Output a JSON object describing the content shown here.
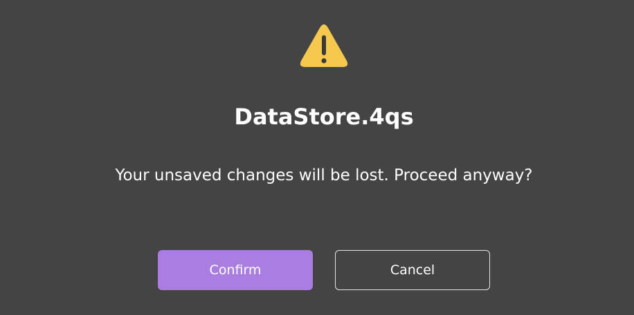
{
  "dialog": {
    "icon": "warning-icon",
    "icon_color": "#f6c94e",
    "title": "DataStore.4qs",
    "message": "Your unsaved changes will be lost. Proceed anyway?",
    "confirm_label": "Confirm",
    "cancel_label": "Cancel",
    "confirm_color": "#a97ee0",
    "background_color": "#444444"
  }
}
